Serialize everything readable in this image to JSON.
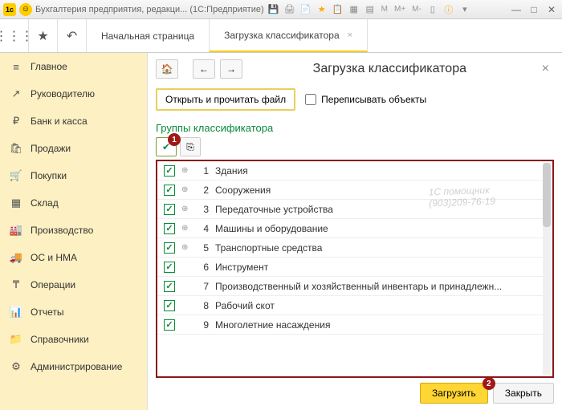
{
  "titlebar": {
    "title": "Бухгалтерия предприятия, редакци... (1С:Предприятие)",
    "m_labels": [
      "M",
      "M+",
      "M-"
    ]
  },
  "tabs": {
    "home": "Начальная страница",
    "active": "Загрузка классификатора"
  },
  "sidebar": {
    "items": [
      {
        "icon": "≡",
        "label": "Главное"
      },
      {
        "icon": "↗",
        "label": "Руководителю"
      },
      {
        "icon": "₽",
        "label": "Банк и касса"
      },
      {
        "icon": "🛍",
        "label": "Продажи"
      },
      {
        "icon": "🛒",
        "label": "Покупки"
      },
      {
        "icon": "▦",
        "label": "Склад"
      },
      {
        "icon": "🏭",
        "label": "Производство"
      },
      {
        "icon": "🚚",
        "label": "ОС и НМА"
      },
      {
        "icon": "₸",
        "label": "Операции"
      },
      {
        "icon": "📊",
        "label": "Отчеты"
      },
      {
        "icon": "📁",
        "label": "Справочники"
      },
      {
        "icon": "⚙",
        "label": "Администрирование"
      }
    ]
  },
  "page": {
    "title": "Загрузка классификатора",
    "open_btn": "Открыть и прочитать файл",
    "overwrite_label": "Переписывать объекты",
    "section_title": "Группы классификатора",
    "marker1": "1",
    "marker2": "2",
    "rows": [
      {
        "num": "1",
        "name": "Здания",
        "exp": true
      },
      {
        "num": "2",
        "name": "Сооружения",
        "exp": true
      },
      {
        "num": "3",
        "name": "Передаточные устройства",
        "exp": true
      },
      {
        "num": "4",
        "name": "Машины и оборудование",
        "exp": true
      },
      {
        "num": "5",
        "name": "Транспортные средства",
        "exp": true
      },
      {
        "num": "6",
        "name": "Инструмент",
        "exp": false
      },
      {
        "num": "7",
        "name": "Производственный и хозяйственный инвентарь и принадлежн...",
        "exp": false
      },
      {
        "num": "8",
        "name": "Рабочий скот",
        "exp": false
      },
      {
        "num": "9",
        "name": "Многолетние насаждения",
        "exp": false
      }
    ],
    "load_btn": "Загрузить",
    "close_btn": "Закрыть"
  },
  "watermark": {
    "line1": "1С помощник",
    "line2": "(903)209-76-19"
  }
}
